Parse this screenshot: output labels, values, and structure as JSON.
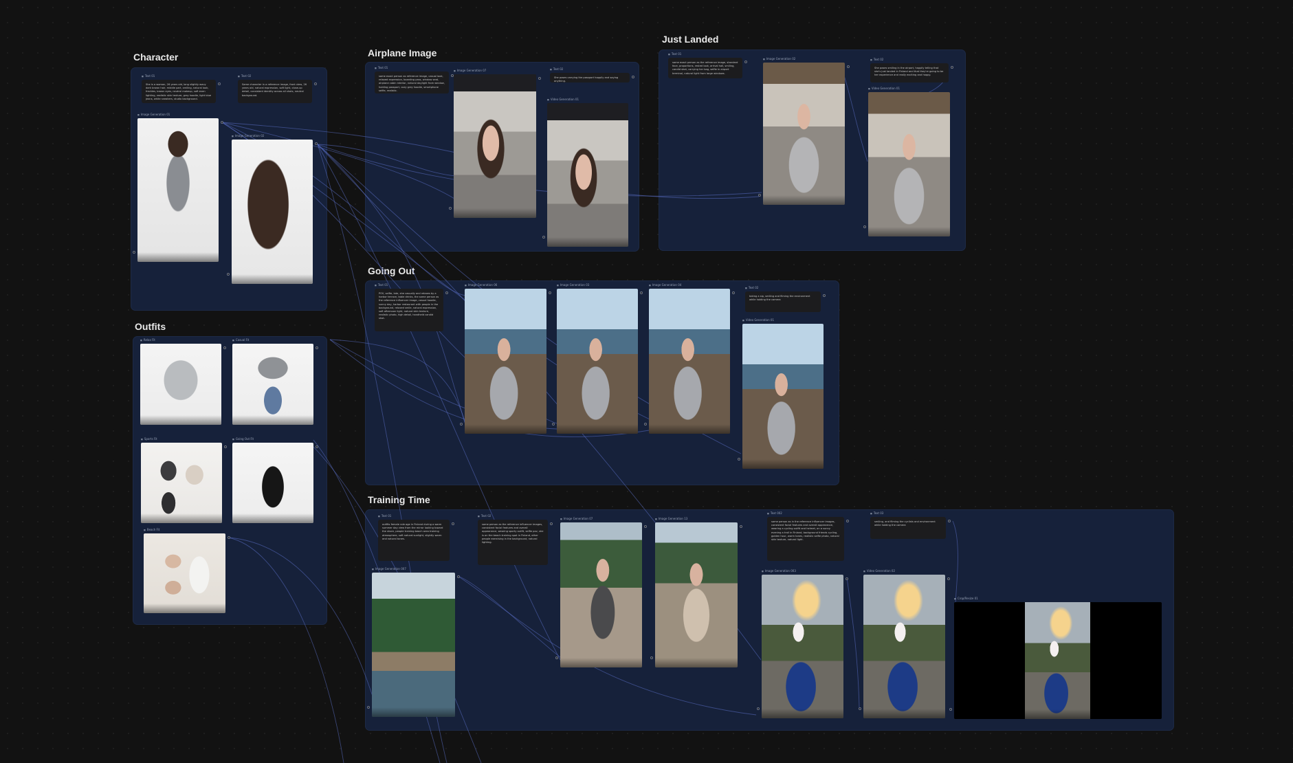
{
  "groups": {
    "character": "Character",
    "outfits": "Outfits",
    "airplane": "Airplane Image",
    "landed": "Just Landed",
    "going_out": "Going Out",
    "training": "Training Time"
  },
  "nodes": {
    "char_text1": {
      "label": "Text 01",
      "body": "She is a woman, 26 years old, long slightly wavy dark brown hair, middle part, smiling, natural look, freckles, brown eyes, neutral makeup, soft even lighting, realistic skin texture, grey hoodie, light blue jeans, white sneakers, studio background."
    },
    "char_text2": {
      "label": "Text 02",
      "body": "Same character in a reference image, front view, 26 years old, natural expression, soft light, close-up detail, consistent identity across all shots, neutral background."
    },
    "char_img1": {
      "label": "Image Generation 01"
    },
    "char_img2": {
      "label": "Image Generation 02"
    },
    "out_relax": {
      "label": "Relax Fit"
    },
    "out_casual": {
      "label": "Casual Fit"
    },
    "out_sports": {
      "label": "Sports Fit"
    },
    "out_goingout": {
      "label": "Going Out Fit"
    },
    "out_beach": {
      "label": "Beach Fit"
    },
    "air_text1": {
      "label": "Text 01",
      "body": "same exact person as reference image, casual look, relaxed expression, boarding pass, window seat, airplane cabin interior, natural daylight from window, holding passport, cozy grey hoodie, smartphone selfie, realistic."
    },
    "air_img1": {
      "label": "Image Generation 07"
    },
    "air_text2": {
      "label": "Text 02",
      "body": "She poses carrying the passport happily and saying anything."
    },
    "air_vid": {
      "label": "Video Generation 01"
    },
    "land_text1": {
      "label": "Text 01",
      "body": "same exact person as the reference image, standard face, proportions, rested look, arrival hall, smiling, candid shot, carrying her bag, selfie in airport terminal, natural light from large windows."
    },
    "land_img1": {
      "label": "Image Generation 02"
    },
    "land_text2": {
      "label": "Text 02",
      "body": "She poses smiling in the airport, happily telling that she's just landed in Finland and that they're going to be her experience and really exciting and happy."
    },
    "land_vid": {
      "label": "Video Generation 01"
    },
    "go_text1": {
      "label": "Text 01",
      "body": "POV, selfie, late, she casually and relaxes by a harbor terrace, table drinks, the same person as the reference influencer image, casual hoodie, sunny day, harbor restaurant with people in the background, relaxed smile, natural expression, soft afternoon light, natural skin texture, realistic photo, high detail, handheld candid shot."
    },
    "go_img1": {
      "label": "Image Generation 06"
    },
    "go_img2": {
      "label": "Image Generation 03"
    },
    "go_img3": {
      "label": "Image Generation 04"
    },
    "go_text2": {
      "label": "Text 02",
      "body": "taking a sip, smiling and filming the environment while holding the camera"
    },
    "go_vid": {
      "label": "Video Generation 01"
    },
    "tr_text1": {
      "label": "Text 01",
      "body": "outfits female role age in Finland during a warm summer day view from the mirror looking toward the shore, people training beach area training atmosphere, soft natural sunlight, slightly warm and natural tones."
    },
    "tr_img0": {
      "label": "Image Generation 007"
    },
    "tr_text2": {
      "label": "Text 02",
      "body": "same person as the reference influencer images, consistent facial features and overall appearance, wearing sporty outfit, selfie pov, she is on the beach training spot in Finland, other people exercising in the background, natural lighting."
    },
    "tr_img1": {
      "label": "Image Generation 07"
    },
    "tr_img2": {
      "label": "Image Generation 13"
    },
    "tr_text3": {
      "label": "Text 002",
      "body": "same person as in the reference influencer images, consistent facial features and overall appearance, wearing a cycling outfit and helmet, on a sunny evening a trail in Finland, background friends cycling, golden hour, warm tones, realistic selfie photo, natural skin texture, natural light."
    },
    "tr_text4": {
      "label": "Text 03",
      "body": "smiling, and filming the cyclists and environment while holding the camera"
    },
    "tr_img3": {
      "label": "Image Generation 003"
    },
    "tr_vid": {
      "label": "Video Generation 02"
    },
    "tr_crop": {
      "label": "Crop/Resize 01"
    }
  }
}
